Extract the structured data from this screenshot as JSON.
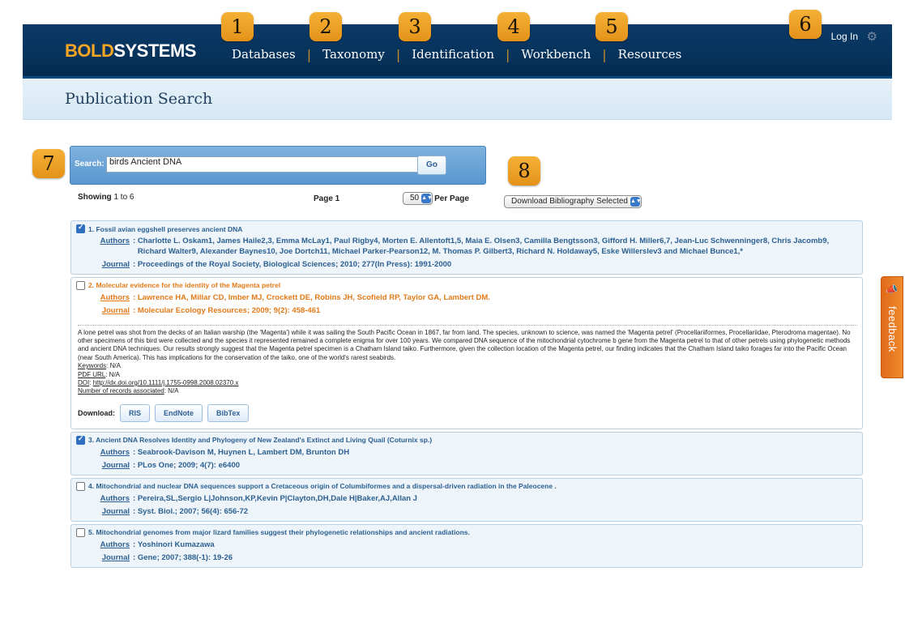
{
  "header": {
    "logo_bold": "BOLD",
    "logo_systems": "SYSTEMS",
    "nav": [
      "Databases",
      "Taxonomy",
      "Identification",
      "Workbench",
      "Resources"
    ],
    "login": "Log In",
    "badges": [
      "1",
      "2",
      "3",
      "4",
      "5",
      "6",
      "7",
      "8"
    ]
  },
  "page": {
    "title": "Publication Search"
  },
  "search": {
    "label": "Search:",
    "value": "birds Ancient DNA",
    "go": "Go"
  },
  "pager": {
    "showing_label": "Showing",
    "showing_range": "1 to 6",
    "page": "Page 1",
    "per_page_value": "50",
    "per_page_label": "Per Page",
    "download_selected": "Download Bibliography Selected"
  },
  "labels": {
    "authors": "Authors",
    "journal": "Journal",
    "download": "Download:"
  },
  "results": [
    {
      "title": "1. Fossil avian eggshell preserves ancient DNA",
      "authors": "Charlotte L. Oskam1, James Haile2,3, Emma McLay1, Paul Rigby4, Morten E. Allentoft1,5, Maia E. Olsen3, Camilla Bengtsson3, Gifford H. Miller6,7, Jean-Luc Schwenninger8, Chris Jacomb9, Richard Walter9, Alexander Baynes10, Joe Dortch11, Michael Parker-Pearson12, M. Thomas P. Gilbert3, Richard N. Holdaway5, Eske Willerslev3 and Michael Bunce1,*",
      "journal": "Proceedings of the Royal Society, Biological Sciences; 2010; 277(In Press): 1991-2000"
    },
    {
      "title": "2. Molecular evidence for the identity of the Magenta petrel",
      "authors": "Lawrence HA, Millar CD, Imber MJ, Crockett DE, Robins JH, Scofield RP, Taylor GA, Lambert DM.",
      "journal": "Molecular Ecology Resources; 2009; 9(2): 458-461",
      "abstract": "A lone petrel was shot from the decks of an Italian warship (the 'Magenta') while it was sailing the South Pacific Ocean in 1867, far from land. The species, unknown to science, was named the 'Magenta petrel' (Procellariiformes, Procellariidae, Pterodroma magentae). No other specimens of this bird were collected and the species it represented remained a complete enigma for over 100 years. We compared DNA sequence of the mitochondrial cytochrome b gene from the Magenta petrel to that of other petrels using phylogenetic methods and ancient DNA techniques. Our results strongly suggest that the Magenta petrel specimen is a Chatham Island taiko. Furthermore, given the collection location of the Magenta petrel, our finding indicates that the Chatham Island taiko forages far into the Pacific Ocean (near South America). This has implications for the conservation of the taiko, one of the world's rarest seabirds.",
      "keywords_label": "Keywords",
      "keywords": ": N/A",
      "pdf_label": "PDF URL",
      "pdf": ": N/A",
      "doi_label": "DOI",
      "doi": "http://dx.doi.org/10.1111/j.1755-0998.2008.02370.x",
      "records_label": "Number of records associated",
      "records": ": N/A",
      "downloads": [
        "RIS",
        "EndNote",
        "BibTex"
      ]
    },
    {
      "title": "3. Ancient DNA Resolves Identity and Phylogeny of New Zealand's Extinct and Living Quail (Coturnix sp.)",
      "authors": "Seabrook-Davison M, Huynen L, Lambert DM, Brunton DH",
      "journal": "PLos One; 2009; 4(7): e6400"
    },
    {
      "title": "4. Mitochondrial and nuclear DNA sequences support a Cretaceous origin of Columbiformes and a dispersal-driven radiation in the Paleocene .",
      "authors": "Pereira,SL,Sergio L|Johnson,KP,Kevin P|Clayton,DH,Dale H|Baker,AJ,Allan J",
      "journal": "Syst. Biol.; 2007; 56(4): 656-72"
    },
    {
      "title": "5. Mitochondrial genomes from major lizard families suggest their phylogenetic relationships and ancient radiations.",
      "authors": "Yoshinori Kumazawa",
      "journal": "Gene; 2007; 388(-1): 19-26"
    }
  ],
  "feedback": {
    "label": "feedback"
  },
  "colors": {
    "nav_bg": "#06335c",
    "accent_orange": "#f6a623",
    "link_blue": "#2b5f92",
    "selected_orange": "#e37a19"
  }
}
